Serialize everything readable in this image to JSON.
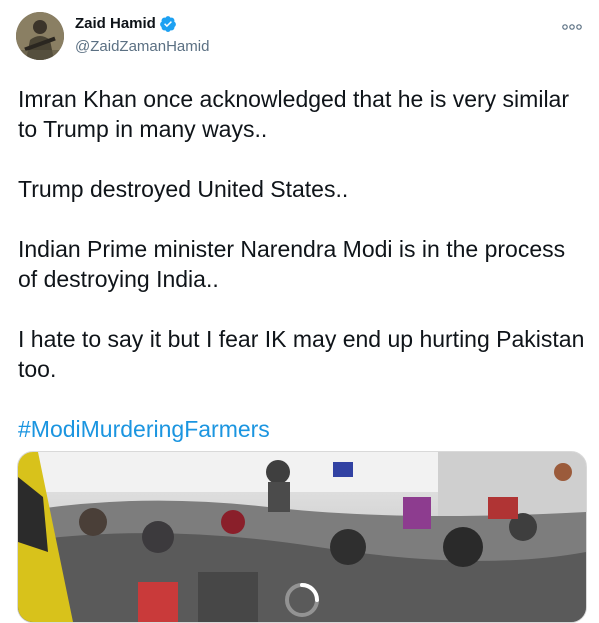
{
  "author": {
    "display_name": "Zaid Hamid",
    "handle": "@ZaidZamanHamid",
    "verified": true,
    "avatar_icon": "profile-photo"
  },
  "tweet": {
    "paragraphs": [
      "Imran Khan once acknowledged that he is very similar to Trump in many ways..",
      "Trump destroyed United States..",
      "Indian Prime minister Narendra Modi is in the process of destroying India..",
      "I hate to say it but I fear IK may end up hurting Pakistan too."
    ],
    "hashtag": "#ModiMurderingFarmers"
  },
  "media": {
    "type": "video",
    "icon": "loading-spinner-icon"
  },
  "colors": {
    "link": "#1b95e0",
    "verified_badge": "#1da1f2",
    "secondary_text": "#5b7083"
  }
}
